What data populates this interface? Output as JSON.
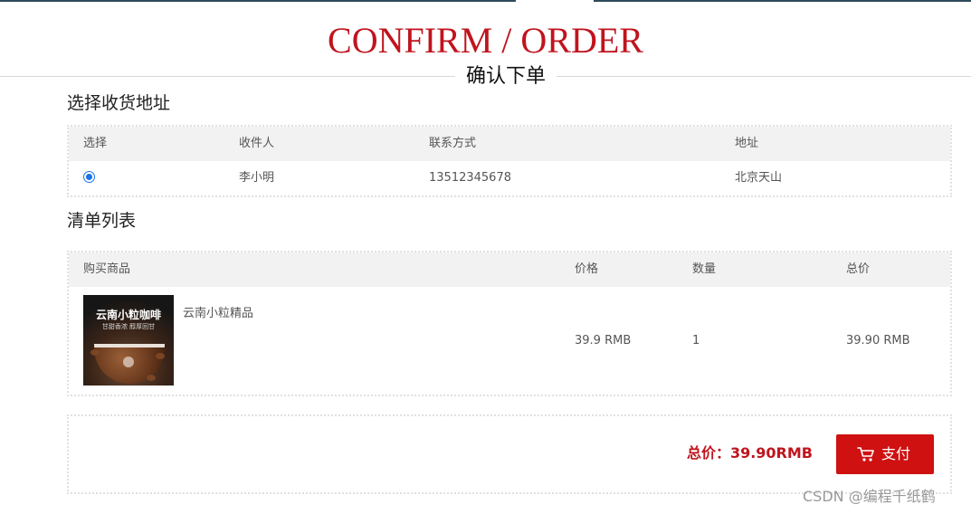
{
  "header": {
    "title_en": "CONFIRM / ORDER",
    "title_cn": "确认下单"
  },
  "address_section": {
    "title": "选择收货地址",
    "columns": [
      "选择",
      "收件人",
      "联系方式",
      "地址"
    ],
    "rows": [
      {
        "selected": true,
        "recipient": "李小明",
        "phone": "13512345678",
        "address": "北京天山"
      }
    ]
  },
  "list_section": {
    "title": "清单列表",
    "columns": [
      "购买商品",
      "价格",
      "数量",
      "总价"
    ],
    "items": [
      {
        "image_text_main": "云南小粒咖啡",
        "image_text_sub": "甘甜香浓 醇厚回甘",
        "name": "云南小粒精品",
        "price": "39.9 RMB",
        "quantity": "1",
        "subtotal": "39.90 RMB"
      }
    ]
  },
  "footer": {
    "total_label": "总价：39.90RMB",
    "pay_label": "支付",
    "pay_icon": "cart-icon",
    "accent_color": "#c0141e"
  },
  "watermark": "CSDN @编程千纸鹤"
}
